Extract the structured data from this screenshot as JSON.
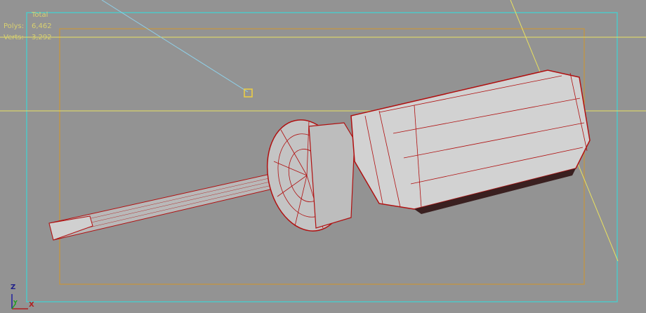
{
  "viewport": {
    "background": "#939393",
    "safe_frame_color": "#4fc8c8",
    "render_frame_color": "#c8963c",
    "wire_color": "#b01010",
    "light_line_color": "#e8e060"
  },
  "stats": {
    "header": "Total",
    "polys_label": "Polys:",
    "polys_value": "6,462",
    "verts_label": "Verts:",
    "verts_value": "3,292"
  },
  "axis_gizmo": {
    "z": "Z",
    "y": "Y",
    "x": "X"
  }
}
